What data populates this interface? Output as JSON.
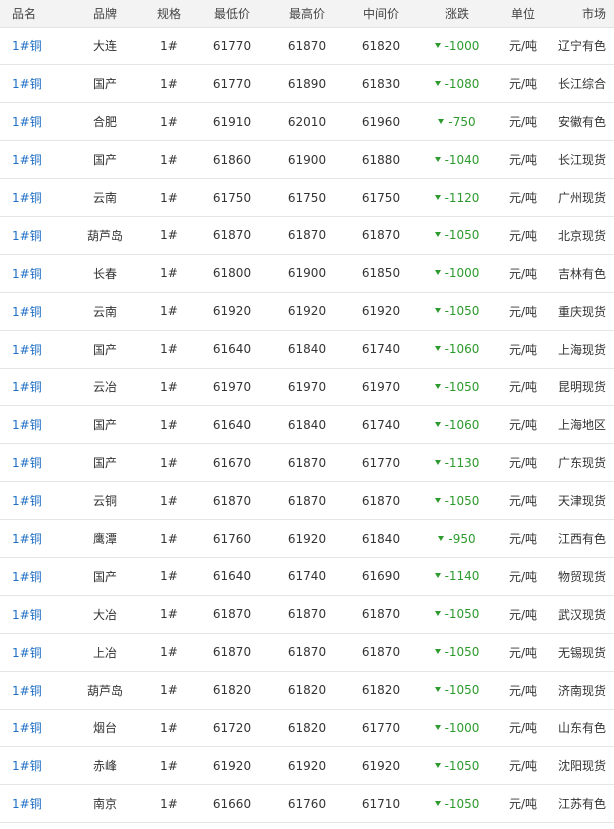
{
  "table": {
    "headers": {
      "name": "品名",
      "brand": "品牌",
      "spec": "规格",
      "low": "最低价",
      "high": "最高价",
      "mid": "中间价",
      "change": "涨跌",
      "unit": "单位",
      "market": "市场"
    },
    "rows": [
      {
        "name": "1#铜",
        "brand": "大连",
        "spec": "1#",
        "low": "61770",
        "high": "61870",
        "mid": "61820",
        "change": "-1000",
        "unit": "元/吨",
        "market": "辽宁有色"
      },
      {
        "name": "1#铜",
        "brand": "国产",
        "spec": "1#",
        "low": "61770",
        "high": "61890",
        "mid": "61830",
        "change": "-1080",
        "unit": "元/吨",
        "market": "长江综合"
      },
      {
        "name": "1#铜",
        "brand": "合肥",
        "spec": "1#",
        "low": "61910",
        "high": "62010",
        "mid": "61960",
        "change": "-750",
        "unit": "元/吨",
        "market": "安徽有色"
      },
      {
        "name": "1#铜",
        "brand": "国产",
        "spec": "1#",
        "low": "61860",
        "high": "61900",
        "mid": "61880",
        "change": "-1040",
        "unit": "元/吨",
        "market": "长江现货"
      },
      {
        "name": "1#铜",
        "brand": "云南",
        "spec": "1#",
        "low": "61750",
        "high": "61750",
        "mid": "61750",
        "change": "-1120",
        "unit": "元/吨",
        "market": "广州现货"
      },
      {
        "name": "1#铜",
        "brand": "葫芦岛",
        "spec": "1#",
        "low": "61870",
        "high": "61870",
        "mid": "61870",
        "change": "-1050",
        "unit": "元/吨",
        "market": "北京现货"
      },
      {
        "name": "1#铜",
        "brand": "长春",
        "spec": "1#",
        "low": "61800",
        "high": "61900",
        "mid": "61850",
        "change": "-1000",
        "unit": "元/吨",
        "market": "吉林有色"
      },
      {
        "name": "1#铜",
        "brand": "云南",
        "spec": "1#",
        "low": "61920",
        "high": "61920",
        "mid": "61920",
        "change": "-1050",
        "unit": "元/吨",
        "market": "重庆现货"
      },
      {
        "name": "1#铜",
        "brand": "国产",
        "spec": "1#",
        "low": "61640",
        "high": "61840",
        "mid": "61740",
        "change": "-1060",
        "unit": "元/吨",
        "market": "上海现货"
      },
      {
        "name": "1#铜",
        "brand": "云冶",
        "spec": "1#",
        "low": "61970",
        "high": "61970",
        "mid": "61970",
        "change": "-1050",
        "unit": "元/吨",
        "market": "昆明现货"
      },
      {
        "name": "1#铜",
        "brand": "国产",
        "spec": "1#",
        "low": "61640",
        "high": "61840",
        "mid": "61740",
        "change": "-1060",
        "unit": "元/吨",
        "market": "上海地区"
      },
      {
        "name": "1#铜",
        "brand": "国产",
        "spec": "1#",
        "low": "61670",
        "high": "61870",
        "mid": "61770",
        "change": "-1130",
        "unit": "元/吨",
        "market": "广东现货"
      },
      {
        "name": "1#铜",
        "brand": "云铜",
        "spec": "1#",
        "low": "61870",
        "high": "61870",
        "mid": "61870",
        "change": "-1050",
        "unit": "元/吨",
        "market": "天津现货"
      },
      {
        "name": "1#铜",
        "brand": "鹰潭",
        "spec": "1#",
        "low": "61760",
        "high": "61920",
        "mid": "61840",
        "change": "-950",
        "unit": "元/吨",
        "market": "江西有色"
      },
      {
        "name": "1#铜",
        "brand": "国产",
        "spec": "1#",
        "low": "61640",
        "high": "61740",
        "mid": "61690",
        "change": "-1140",
        "unit": "元/吨",
        "market": "物贸现货"
      },
      {
        "name": "1#铜",
        "brand": "大冶",
        "spec": "1#",
        "low": "61870",
        "high": "61870",
        "mid": "61870",
        "change": "-1050",
        "unit": "元/吨",
        "market": "武汉现货"
      },
      {
        "name": "1#铜",
        "brand": "上冶",
        "spec": "1#",
        "low": "61870",
        "high": "61870",
        "mid": "61870",
        "change": "-1050",
        "unit": "元/吨",
        "market": "无锡现货"
      },
      {
        "name": "1#铜",
        "brand": "葫芦岛",
        "spec": "1#",
        "low": "61820",
        "high": "61820",
        "mid": "61820",
        "change": "-1050",
        "unit": "元/吨",
        "market": "济南现货"
      },
      {
        "name": "1#铜",
        "brand": "烟台",
        "spec": "1#",
        "low": "61720",
        "high": "61820",
        "mid": "61770",
        "change": "-1000",
        "unit": "元/吨",
        "market": "山东有色"
      },
      {
        "name": "1#铜",
        "brand": "赤峰",
        "spec": "1#",
        "low": "61920",
        "high": "61920",
        "mid": "61920",
        "change": "-1050",
        "unit": "元/吨",
        "market": "沈阳现货"
      },
      {
        "name": "1#铜",
        "brand": "南京",
        "spec": "1#",
        "low": "61660",
        "high": "61760",
        "mid": "61710",
        "change": "-1050",
        "unit": "元/吨",
        "market": "江苏有色"
      }
    ]
  },
  "colors": {
    "link": "#1f6fc5",
    "down": "#2c9a2c",
    "header_bg": "#f3f3f3",
    "border": "#e6e6e6"
  },
  "icons": {
    "change_direction": "down-triangle-icon"
  }
}
